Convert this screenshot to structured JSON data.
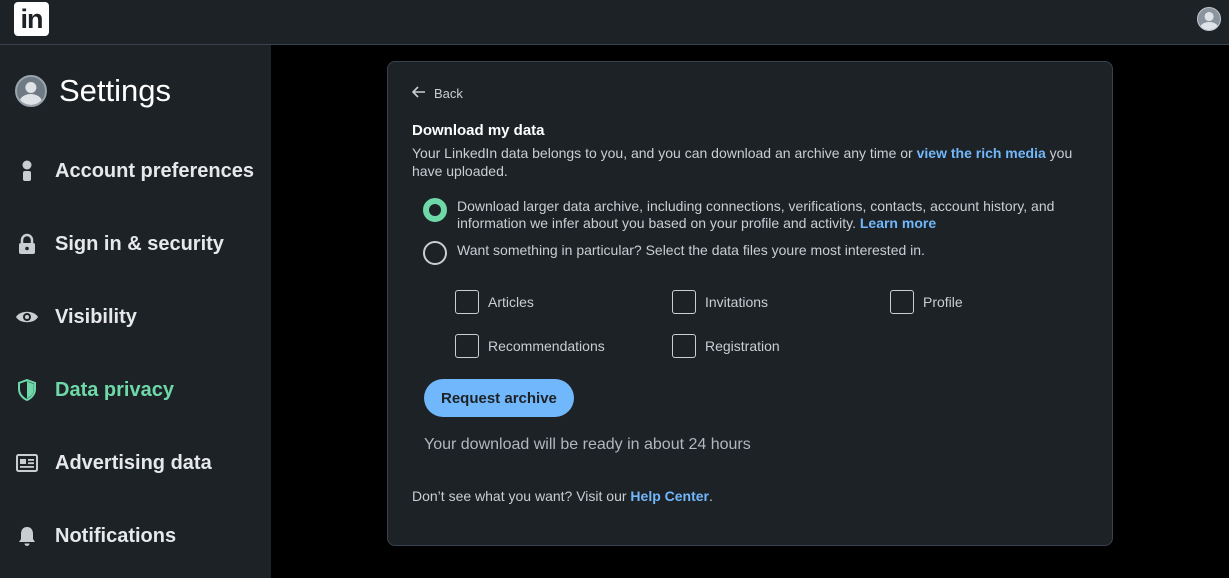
{
  "topbar": {
    "logo_text": "in"
  },
  "sidebar": {
    "title": "Settings",
    "items": [
      {
        "label": "Account preferences",
        "icon": "person-icon"
      },
      {
        "label": "Sign in & security",
        "icon": "lock-icon"
      },
      {
        "label": "Visibility",
        "icon": "eye-icon"
      },
      {
        "label": "Data privacy",
        "icon": "shield-icon",
        "active": true
      },
      {
        "label": "Advertising data",
        "icon": "newspaper-icon"
      },
      {
        "label": "Notifications",
        "icon": "bell-icon"
      }
    ]
  },
  "card": {
    "back_label": "Back",
    "heading": "Download my data",
    "desc_before": "Your LinkedIn data belongs to you, and you can download an archive any time or ",
    "desc_link": "view the rich media",
    "desc_after": " you have uploaded.",
    "option_full": {
      "text": "Download larger data archive, including connections, verifications, contacts, account history, and information we infer about you based on your profile and activity. ",
      "link": "Learn more",
      "selected": true
    },
    "option_particular": {
      "text": "Want something in particular? Select the data files youre most interested in.",
      "selected": false
    },
    "checkboxes": [
      "Articles",
      "Invitations",
      "Profile",
      "Recommendations",
      "Registration"
    ],
    "request_button": "Request archive",
    "ready_text": "Your download will be ready in about 24 hours",
    "help_before": "Don’t see what you want? Visit our ",
    "help_link": "Help Center",
    "help_after": "."
  },
  "colors": {
    "accent": "#71b7fb",
    "active": "#6fd8a8",
    "panel": "#1d2226",
    "background": "#000000"
  }
}
